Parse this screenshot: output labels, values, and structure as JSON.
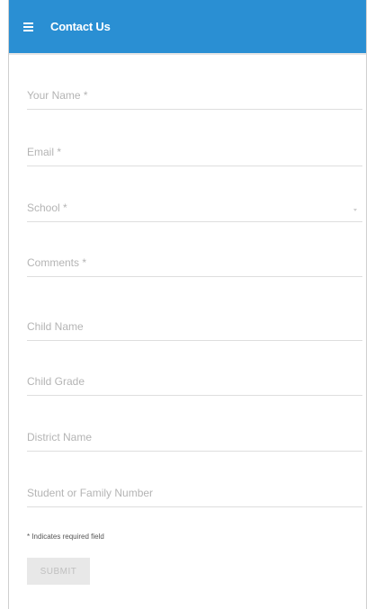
{
  "header": {
    "title": "Contact Us",
    "menu_icon": "hamburger-menu-icon",
    "background_color": "#2a8fd3"
  },
  "form": {
    "fields": [
      {
        "label": "Your Name *",
        "value": ""
      },
      {
        "label": "Email *",
        "value": ""
      },
      {
        "label": "School *",
        "value": "",
        "type": "select"
      },
      {
        "label": "Comments *",
        "value": ""
      },
      {
        "label": "Child Name",
        "value": ""
      },
      {
        "label": "Child Grade",
        "value": ""
      },
      {
        "label": "District Name",
        "value": ""
      },
      {
        "label": "Student or Family Number",
        "value": ""
      }
    ],
    "required_note": "* Indicates required field",
    "submit_label": "SUBMIT"
  }
}
